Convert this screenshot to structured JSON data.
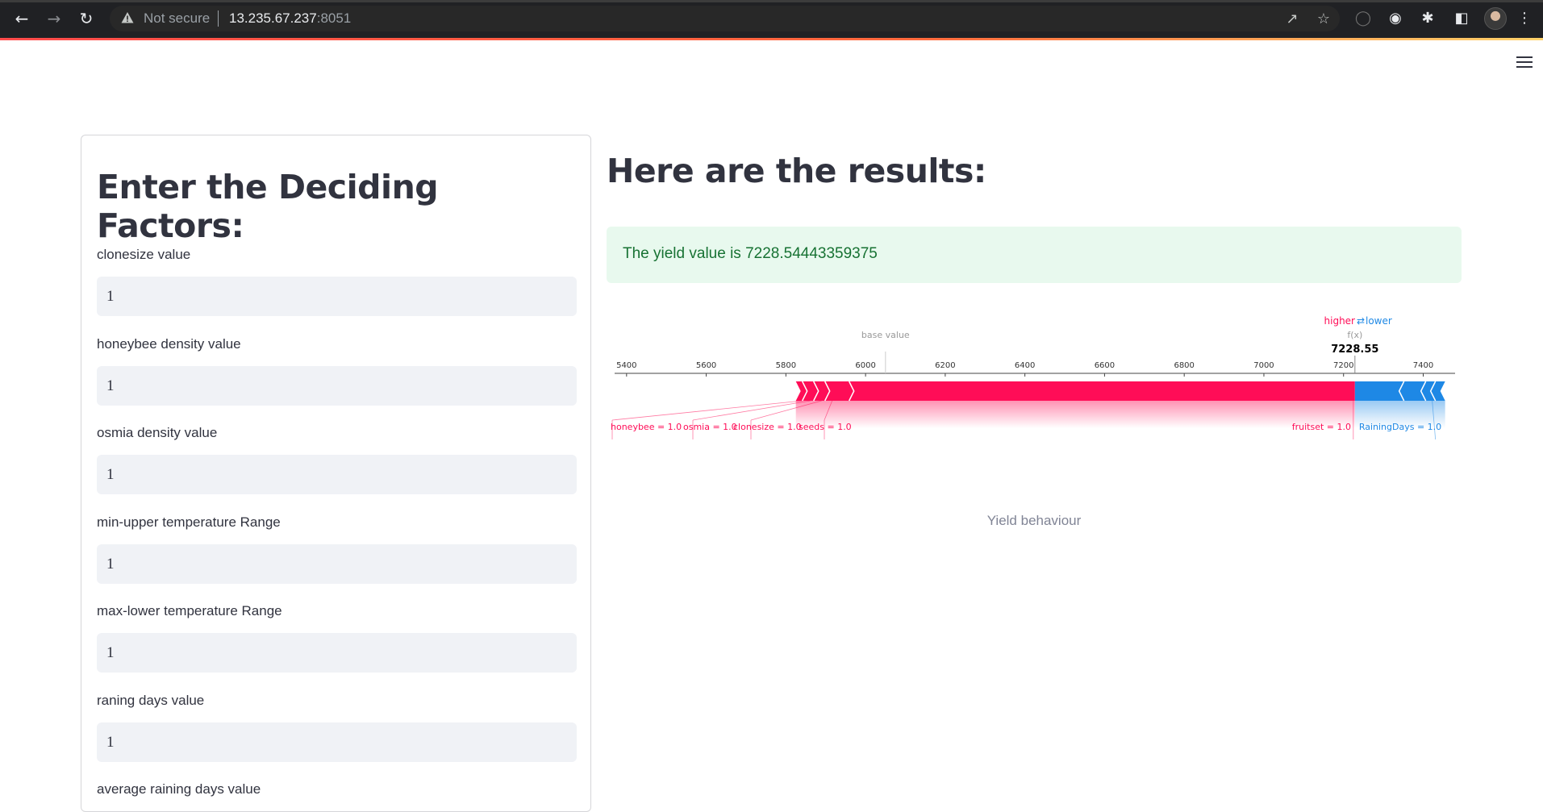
{
  "browser": {
    "security_label": "Not secure",
    "url_host": "13.235.67.237",
    "url_port": ":8051"
  },
  "form": {
    "title": "Enter the Deciding Factors:",
    "fields": [
      {
        "label": "clonesize value",
        "value": "1"
      },
      {
        "label": "honeybee density value",
        "value": "1"
      },
      {
        "label": "osmia density value",
        "value": "1"
      },
      {
        "label": "min-upper temperature Range",
        "value": "1"
      },
      {
        "label": "max-lower temperature Range",
        "value": "1"
      },
      {
        "label": "raning days value",
        "value": "1"
      },
      {
        "label": "average raining days value",
        "value": ""
      }
    ]
  },
  "results": {
    "title": "Here are the results:",
    "message": "The yield value is 7228.54443359375",
    "caption": "Yield behaviour"
  },
  "chart_data": {
    "type": "force-plot",
    "legend_higher": "higher",
    "legend_arrows": "⇄",
    "legend_lower": "lower",
    "base_label": "base value",
    "fx_label": "f(x)",
    "fx_value": "7228.55",
    "base_value": 6050,
    "output_value": 7228.55,
    "ticks": [
      5400,
      5600,
      5800,
      6000,
      6200,
      6400,
      6600,
      6800,
      7000,
      7200,
      7400
    ],
    "xlim": [
      5370,
      7480
    ],
    "bar_start": 5825,
    "bar_end": 7455,
    "higher_color": "#ff0d57",
    "lower_color": "#1e88e5",
    "positive_features": [
      {
        "label": "honeybee = 1.0"
      },
      {
        "label": "osmia = 1.0"
      },
      {
        "label": "clonesize = 1.0"
      },
      {
        "label": "seeds = 1.0"
      },
      {
        "label": "fruitset = 1.0"
      }
    ],
    "negative_features": [
      {
        "label": "RainingDays = 1.0"
      }
    ]
  }
}
